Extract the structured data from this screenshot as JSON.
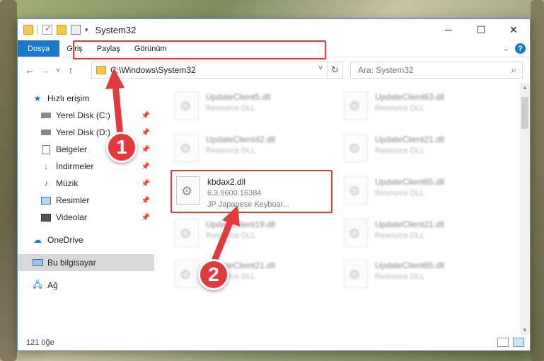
{
  "window": {
    "title": "System32"
  },
  "ribbon": {
    "tabs": [
      "Dosya",
      "Giriş",
      "Paylaş",
      "Görünüm"
    ]
  },
  "address": {
    "path": "C:\\Windows\\System32"
  },
  "search": {
    "placeholder": "Ara: System32"
  },
  "sidebar": {
    "items": [
      {
        "label": "Hızlı erişim",
        "icon": "star-icon"
      },
      {
        "label": "Yerel Disk (C:)",
        "icon": "drive-icon"
      },
      {
        "label": "Yerel Disk (D:)",
        "icon": "drive-icon"
      },
      {
        "label": "Belgeler",
        "icon": "document-icon"
      },
      {
        "label": "İndirmeler",
        "icon": "download-icon"
      },
      {
        "label": "Müzik",
        "icon": "music-icon"
      },
      {
        "label": "Resimler",
        "icon": "picture-icon"
      },
      {
        "label": "Videolar",
        "icon": "video-icon"
      },
      {
        "label": "OneDrive",
        "icon": "cloud-icon"
      },
      {
        "label": "Bu bilgisayar",
        "icon": "computer-icon"
      },
      {
        "label": "Ağ",
        "icon": "network-icon"
      }
    ]
  },
  "files": [
    {
      "name": "UpdateClient5.dll",
      "sub1": "Resource DLL",
      "sub2": ""
    },
    {
      "name": "UpdateClient63.dll",
      "sub1": "Resource DLL",
      "sub2": ""
    },
    {
      "name": "UpdateClient42.dll",
      "sub1": "Resource DLL",
      "sub2": ""
    },
    {
      "name": "UpdateClient21.dll",
      "sub1": "Resource DLL",
      "sub2": ""
    },
    {
      "name": "kbdax2.dll",
      "sub1": "6.3.9600.16384",
      "sub2": "JP Japanese Keyboar..."
    },
    {
      "name": "UpdateClient65.dll",
      "sub1": "Resource DLL",
      "sub2": ""
    },
    {
      "name": "UpdateClient19.dll",
      "sub1": "Resource DLL",
      "sub2": ""
    },
    {
      "name": "UpdateClient21.dll",
      "sub1": "Resource DLL",
      "sub2": ""
    },
    {
      "name": "UpdateClient21.dll",
      "sub1": "Resource DLL",
      "sub2": ""
    },
    {
      "name": "UpdateClient65.dll",
      "sub1": "Resource DLL",
      "sub2": ""
    }
  ],
  "status": {
    "count": "121 öğe"
  },
  "annotations": {
    "step1": "1",
    "step2": "2"
  },
  "colors": {
    "accent": "#1979ca",
    "highlight": "#e0393e",
    "folder": "#f3c94b"
  }
}
